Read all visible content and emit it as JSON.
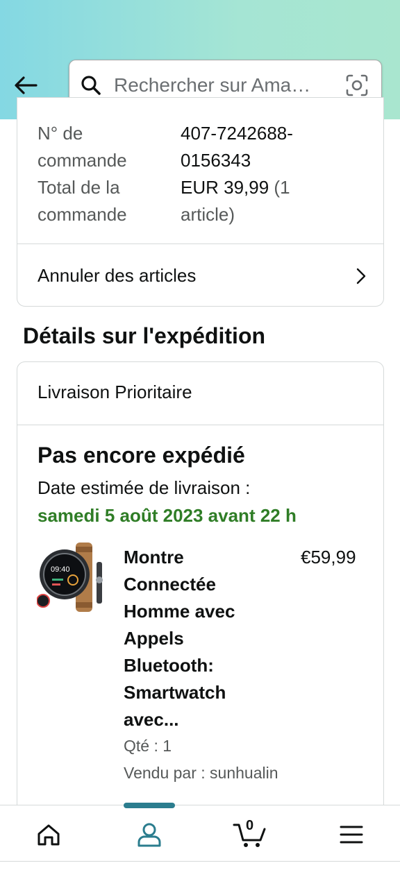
{
  "search": {
    "placeholder": "Rechercher sur Ama…"
  },
  "order": {
    "number_label": "N° de\ncommande",
    "number_value": "407-7242688-\n0156343",
    "total_label": "Total de la\ncommande",
    "total_value": "EUR 39,99",
    "total_count": "(1\narticle)",
    "cancel_label": "Annuler des articles"
  },
  "shipping": {
    "section_title": "Détails sur l'expédition",
    "method": "Livraison Prioritaire",
    "status": "Pas encore expédié",
    "estimate_label": "Date estimée de livraison :",
    "estimate_date": "samedi 5 août 2023 avant 22 h",
    "product": {
      "title": "Montre Connectée Homme avec Appels Bluetooth: Smartwatch avec...",
      "price": "€59,99",
      "qty": "Qté : 1",
      "seller": "Vendu par : sunhualin",
      "image_label": "09:40"
    }
  },
  "nav": {
    "cart_count": "0",
    "active": "profile",
    "accent": "#2b7d8e"
  },
  "colors": {
    "header_gradient": [
      "#84d8e3",
      "#a9e6cf"
    ],
    "date_green": "#2f7d26"
  },
  "icons": [
    "back-arrow-icon",
    "search-icon",
    "camera-icon",
    "chevron-right-icon",
    "home-icon",
    "profile-icon",
    "cart-icon",
    "menu-icon"
  ]
}
